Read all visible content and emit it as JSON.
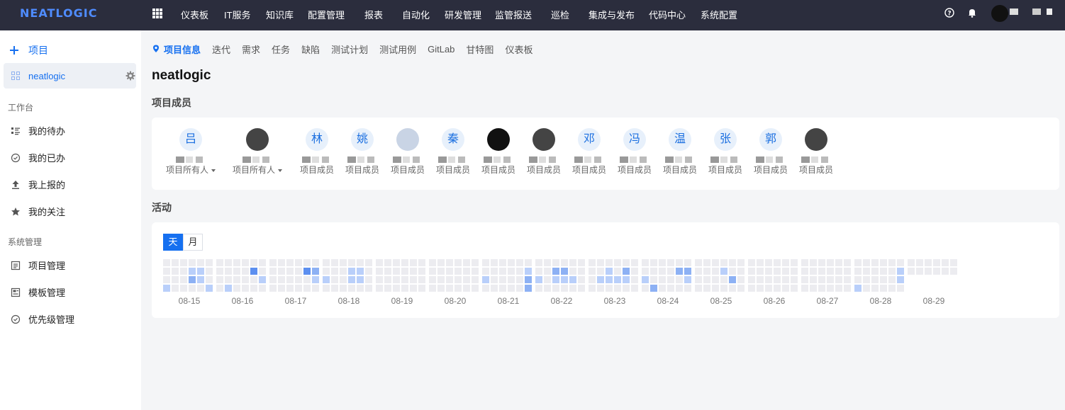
{
  "app": {
    "logo_text": "NEATLOGIC"
  },
  "topnav": {
    "items": [
      "仪表板",
      "IT服务",
      "知识库",
      "配置管理",
      "报表",
      "自动化",
      "研发管理",
      "监管报送",
      "巡检",
      "集成与发布",
      "代码中心",
      "系统配置"
    ]
  },
  "sidebar": {
    "add_label": "项目",
    "current_project": "neatlogic",
    "section_workbench": "工作台",
    "workbench_items": [
      "我的待办",
      "我的已办",
      "我上报的",
      "我的关注"
    ],
    "section_system": "系统管理",
    "system_items": [
      "项目管理",
      "模板管理",
      "优先级管理"
    ]
  },
  "tabs": {
    "items": [
      "项目信息",
      "迭代",
      "需求",
      "任务",
      "缺陷",
      "测试计划",
      "测试用例",
      "GitLab",
      "甘特图",
      "仪表板"
    ],
    "active": "项目信息"
  },
  "project": {
    "name": "neatlogic",
    "members_title": "项目成员",
    "activity_title": "活动"
  },
  "members": [
    {
      "avatar_text": "吕",
      "role": "项目所有人",
      "dropdown": true
    },
    {
      "avatar_text": "",
      "role": "项目所有人",
      "dropdown": true
    },
    {
      "avatar_text": "林",
      "role": "项目成员"
    },
    {
      "avatar_text": "姚",
      "role": "项目成员"
    },
    {
      "avatar_text": "",
      "role": "项目成员"
    },
    {
      "avatar_text": "秦",
      "role": "项目成员"
    },
    {
      "avatar_text": "",
      "role": "项目成员"
    },
    {
      "avatar_text": "",
      "role": "项目成员"
    },
    {
      "avatar_text": "邓",
      "role": "项目成员"
    },
    {
      "avatar_text": "冯",
      "role": "项目成员"
    },
    {
      "avatar_text": "温",
      "role": "项目成员"
    },
    {
      "avatar_text": "张",
      "role": "项目成员"
    },
    {
      "avatar_text": "郭",
      "role": "项目成员"
    },
    {
      "avatar_text": "",
      "role": "项目成员"
    }
  ],
  "activity": {
    "toggle": [
      "天",
      "月"
    ],
    "selected": "天",
    "days": [
      "08-15",
      "08-16",
      "08-17",
      "08-18",
      "08-19",
      "08-20",
      "08-21",
      "08-22",
      "08-23",
      "08-24",
      "08-25",
      "08-26",
      "08-27",
      "08-28",
      "08-29"
    ],
    "colors": {
      "empty": "#ececf0",
      "low": "#b9cffa",
      "mid": "#8db1f4",
      "high": "#5c8ff0"
    }
  }
}
